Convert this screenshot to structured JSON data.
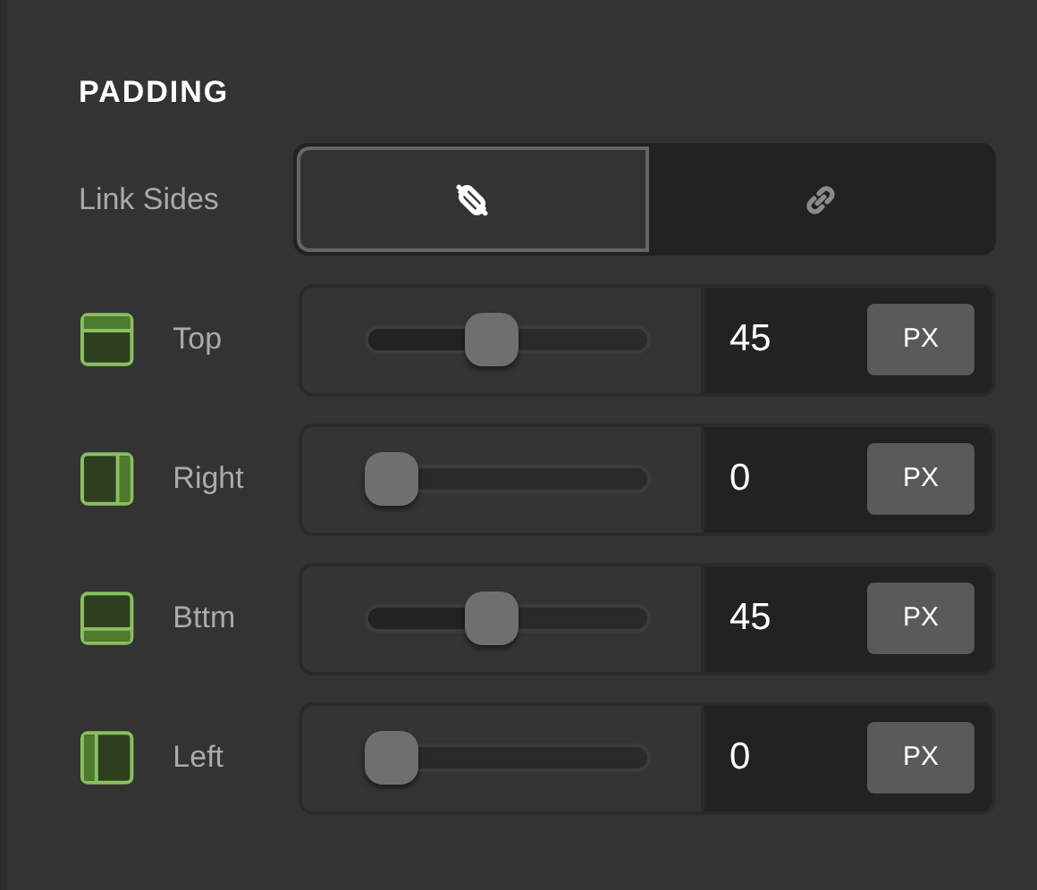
{
  "section_title": "PADDING",
  "link_sides": {
    "label": "Link Sides",
    "options": [
      {
        "kind": "unlink",
        "selected": true
      },
      {
        "kind": "link",
        "selected": false
      }
    ]
  },
  "sides": [
    {
      "kind": "top",
      "label": "Top",
      "level": 0.45,
      "value": "45",
      "unit": "PX"
    },
    {
      "kind": "right",
      "label": "Right",
      "level": 0,
      "value": "0",
      "unit": "PX"
    },
    {
      "kind": "bottom",
      "label": "Bttm",
      "level": 0.45,
      "value": "45",
      "unit": "PX"
    },
    {
      "kind": "left",
      "label": "Left",
      "level": 0,
      "value": "0",
      "unit": "PX"
    }
  ]
}
